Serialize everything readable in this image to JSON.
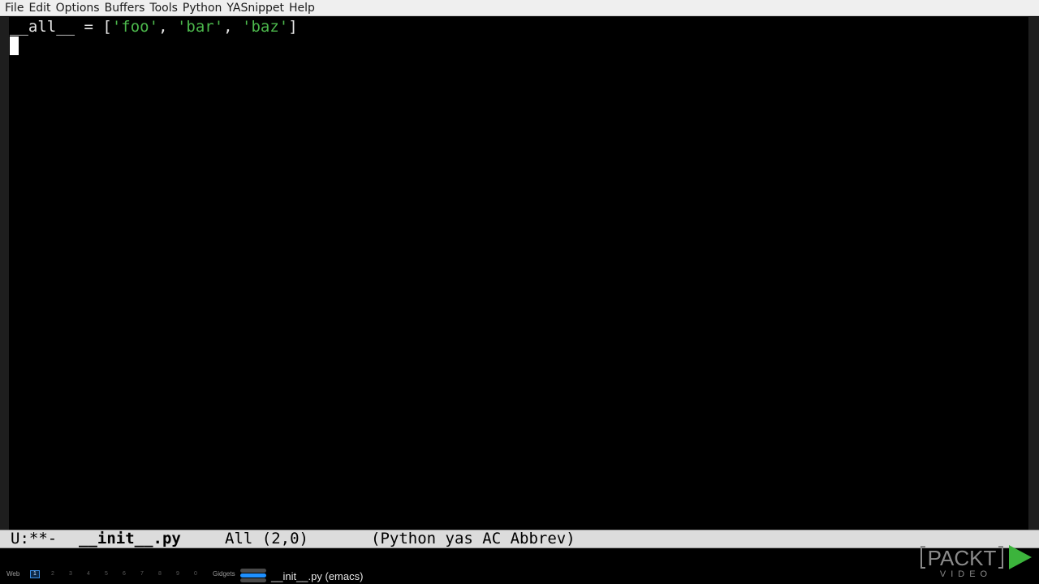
{
  "menu_bar": {
    "items": [
      "File",
      "Edit",
      "Options",
      "Buffers",
      "Tools",
      "Python",
      "YASnippet",
      "Help"
    ]
  },
  "editor": {
    "code_line_1": {
      "name": "__all__",
      "op": " = ",
      "open": "[",
      "str1": "'foo'",
      "sep1": ", ",
      "str2": "'bar'",
      "sep2": ", ",
      "str3": "'baz'",
      "close": "]"
    },
    "colors": {
      "background": "#000000",
      "text": "#e6e6e6",
      "string": "#4cb84c",
      "cursor": "#ffffff"
    }
  },
  "mode_line": {
    "status": "U:**-",
    "buffer_name": "__init__.py",
    "position": "All (2,0)",
    "modes": "(Python yas AC Abbrev)"
  },
  "taskbar": {
    "web_label": "Web",
    "workspaces": [
      "1",
      "2",
      "3",
      "4",
      "5",
      "6",
      "7",
      "8",
      "9",
      "0"
    ],
    "active_workspace": "1",
    "gadgets_label": "Gidgets",
    "task_title": "__init__.py (emacs)",
    "accent": "#1e90ff"
  },
  "watermark": {
    "brand": "PACKT",
    "sub": "VIDEO",
    "play_color": "#3cb43c"
  }
}
